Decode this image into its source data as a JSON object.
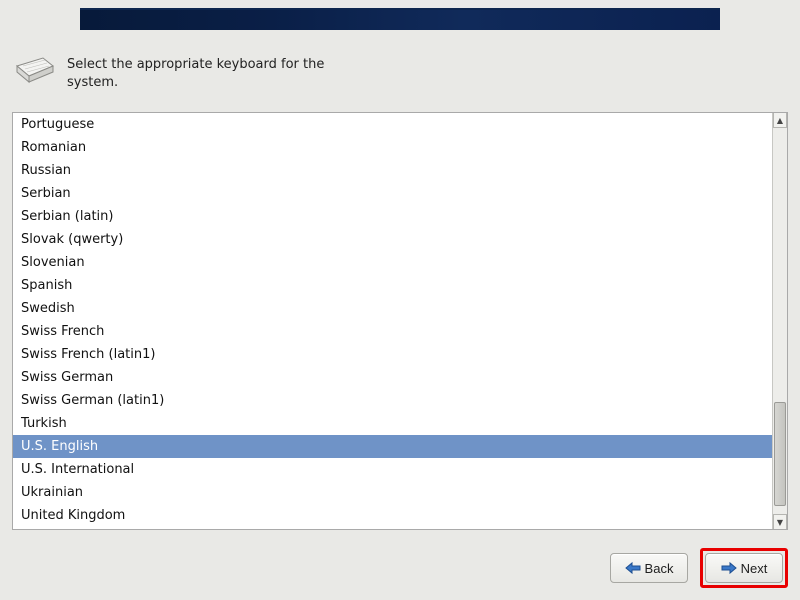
{
  "instruction": "Select the appropriate keyboard for the system.",
  "keyboard_list": {
    "items": [
      "Portuguese",
      "Romanian",
      "Russian",
      "Serbian",
      "Serbian (latin)",
      "Slovak (qwerty)",
      "Slovenian",
      "Spanish",
      "Swedish",
      "Swiss French",
      "Swiss French (latin1)",
      "Swiss German",
      "Swiss German (latin1)",
      "Turkish",
      "U.S. English",
      "U.S. International",
      "Ukrainian",
      "United Kingdom"
    ],
    "selected_index": 14
  },
  "scrollbar": {
    "thumb_top_pct": 71,
    "thumb_height_pct": 27
  },
  "buttons": {
    "back_label": "Back",
    "next_label": "Next"
  },
  "colors": {
    "selection": "#6f93c7",
    "highlight_border": "#e80000",
    "banner_start": "#071a3a",
    "banner_end": "#0b2150"
  }
}
